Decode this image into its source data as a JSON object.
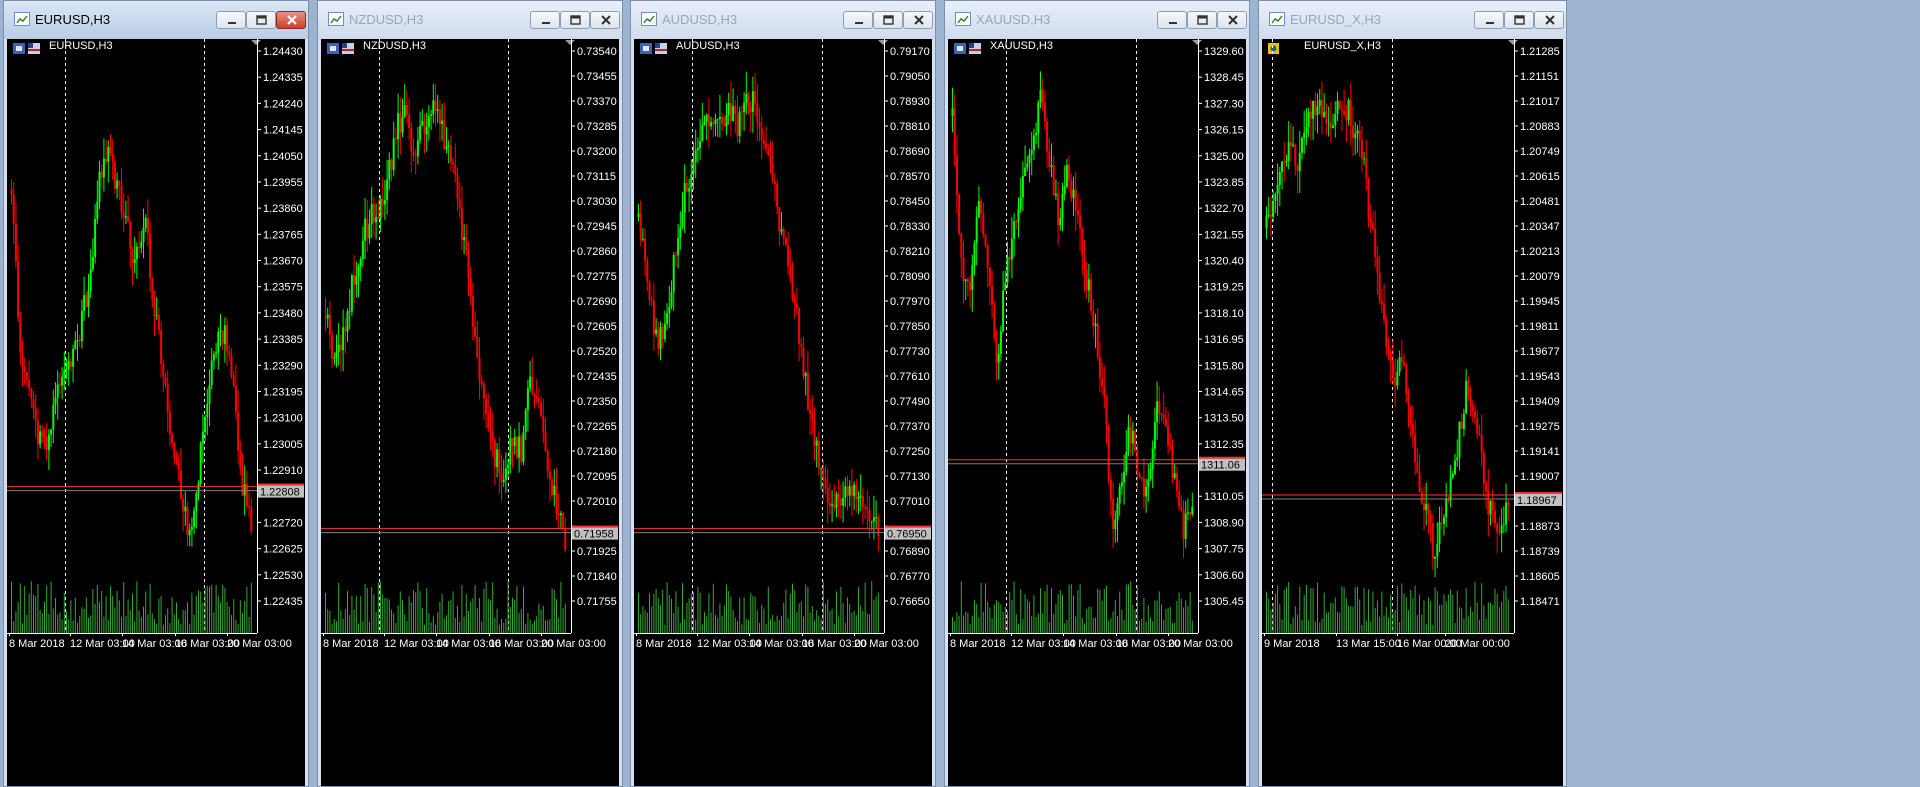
{
  "windows": [
    {
      "id": "eurusd",
      "title": "EURUSD,H3",
      "symbol_label": "EURUSD,H3",
      "active": true,
      "flag_style": "eu-us",
      "price_ticks": [
        "1.24430",
        "1.24335",
        "1.24240",
        "1.24145",
        "1.24050",
        "1.23955",
        "1.23860",
        "1.23765",
        "1.23670",
        "1.23575",
        "1.23480",
        "1.23385",
        "1.23290",
        "1.23195",
        "1.23100",
        "1.23005",
        "1.22910",
        "1.22808",
        "1.22720",
        "1.22625",
        "1.22530",
        "1.22435"
      ],
      "date_labels": [
        "8 Mar 2018",
        "12 Mar 03:00",
        "14 Mar 03:00",
        "16 Mar 03:00",
        "20 Mar 03:00"
      ],
      "current_price": "1.22808"
    },
    {
      "id": "nzdusd",
      "title": "NZDUSD,H3",
      "symbol_label": "NZDUSD,H3",
      "active": false,
      "flag_style": "nz-us",
      "price_ticks": [
        "0.73540",
        "0.73455",
        "0.73370",
        "0.73285",
        "0.73200",
        "0.73115",
        "0.73030",
        "0.72945",
        "0.72860",
        "0.72775",
        "0.72690",
        "0.72605",
        "0.72520",
        "0.72435",
        "0.72350",
        "0.72265",
        "0.72180",
        "0.72095",
        "0.72010",
        "0.71958",
        "0.71925",
        "0.71840",
        "0.71755"
      ],
      "date_labels": [
        "8 Mar 2018",
        "12 Mar 03:00",
        "14 Mar 03:00",
        "16 Mar 03:00",
        "20 Mar 03:00"
      ],
      "current_price": "0.71958"
    },
    {
      "id": "audusd",
      "title": "AUDUSD,H3",
      "symbol_label": "AUDUSD,H3",
      "active": false,
      "flag_style": "au-us",
      "price_ticks": [
        "0.79170",
        "0.79050",
        "0.78930",
        "0.78810",
        "0.78690",
        "0.78570",
        "0.78450",
        "0.78330",
        "0.78210",
        "0.78090",
        "0.77970",
        "0.77850",
        "0.77730",
        "0.77610",
        "0.77490",
        "0.77370",
        "0.77250",
        "0.77130",
        "0.77010",
        "0.76950",
        "0.76890",
        "0.76770",
        "0.76650"
      ],
      "date_labels": [
        "8 Mar 2018",
        "12 Mar 03:00",
        "14 Mar 03:00",
        "16 Mar 03:00",
        "20 Mar 03:00"
      ],
      "current_price": "0.76950"
    },
    {
      "id": "xauusd",
      "title": "XAUUSD,H3",
      "symbol_label": "XAUUSD,H3",
      "active": false,
      "flag_style": "xau-us",
      "price_ticks": [
        "1329.60",
        "1328.45",
        "1327.30",
        "1326.15",
        "1325.00",
        "1323.85",
        "1322.70",
        "1321.55",
        "1320.40",
        "1319.25",
        "1318.10",
        "1316.95",
        "1315.80",
        "1314.65",
        "1313.50",
        "1312.35",
        "1311.06",
        "1310.05",
        "1308.90",
        "1307.75",
        "1306.60",
        "1305.45"
      ],
      "date_labels": [
        "8 Mar 2018",
        "12 Mar 03:00",
        "14 Mar 03:00",
        "16 Mar 03:00",
        "20 Mar 03:00"
      ],
      "current_price": "1311.06"
    },
    {
      "id": "eurusdx",
      "title": "EURUSD_X,H3",
      "symbol_label": "EURUSD_X,H3",
      "active": false,
      "flag_style": "custom",
      "price_ticks": [
        "1.21285",
        "1.21151",
        "1.21017",
        "1.20883",
        "1.20749",
        "1.20615",
        "1.20481",
        "1.20347",
        "1.20213",
        "1.20079",
        "1.19945",
        "1.19811",
        "1.19677",
        "1.19543",
        "1.19409",
        "1.19275",
        "1.19141",
        "1.19007",
        "1.18967",
        "1.18873",
        "1.18739",
        "1.18605",
        "1.18471"
      ],
      "date_labels": [
        "9 Mar 2018",
        "13 Mar 15:00",
        "16 Mar 00:00",
        "20 Mar 00:00"
      ],
      "current_price": "1.18967"
    }
  ],
  "colors": {
    "bull": "#00ff00",
    "bear": "#ff0000",
    "grid": "#ffffff",
    "volume": "#33aa33",
    "bid_line": "#ff3333",
    "ask_line": "#7f7f7f",
    "price_tag": "#c0c0c0"
  },
  "icons": {
    "window": "chart-window-icon",
    "minimize": "minimize-icon",
    "restore": "restore-icon",
    "close": "close-icon",
    "scroll": "chart-shift-triangle-icon"
  }
}
